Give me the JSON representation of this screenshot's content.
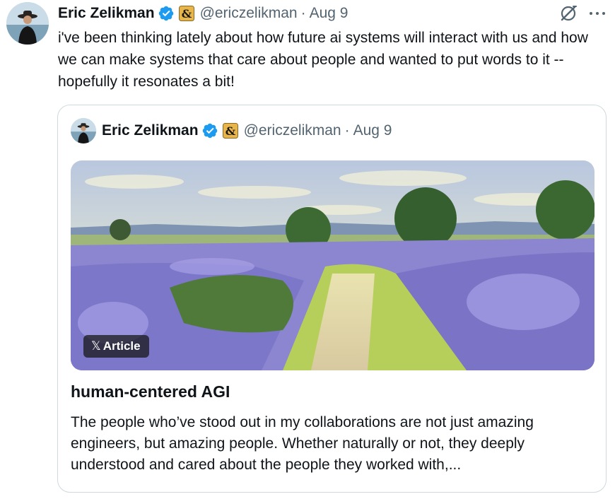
{
  "tweet": {
    "author": {
      "name": "Eric Zelikman",
      "handle": "@ericzelikman",
      "date": "Aug 9",
      "separator": "·",
      "affiliation_glyph": "&"
    },
    "text": "i've been thinking lately about how future ai systems will interact with us and how we can make systems that care about people and wanted to put words to it -- hopefully it resonates a bit!"
  },
  "quoted": {
    "author": {
      "name": "Eric Zelikman",
      "handle": "@ericzelikman",
      "date": "Aug 9",
      "separator": "·",
      "affiliation_glyph": "&"
    },
    "article": {
      "badge_logo": "𝕏",
      "badge_label": "Article",
      "title": "human-centered AGI",
      "excerpt": "The people who’ve stood out in my collaborations are not just amazing engineers, but amazing people. Whether naturally or not, they deeply understood and cared about the people they worked with,..."
    }
  },
  "icons": {
    "verified": "verified-badge-icon",
    "affiliation": "affiliation-badge-icon",
    "grok": "grok-icon",
    "more": "more-icon"
  },
  "colors": {
    "verified_blue": "#1d9bf0",
    "affiliation_gold": "#e8b54a",
    "secondary_text": "#536471",
    "border": "#cfd9de"
  }
}
